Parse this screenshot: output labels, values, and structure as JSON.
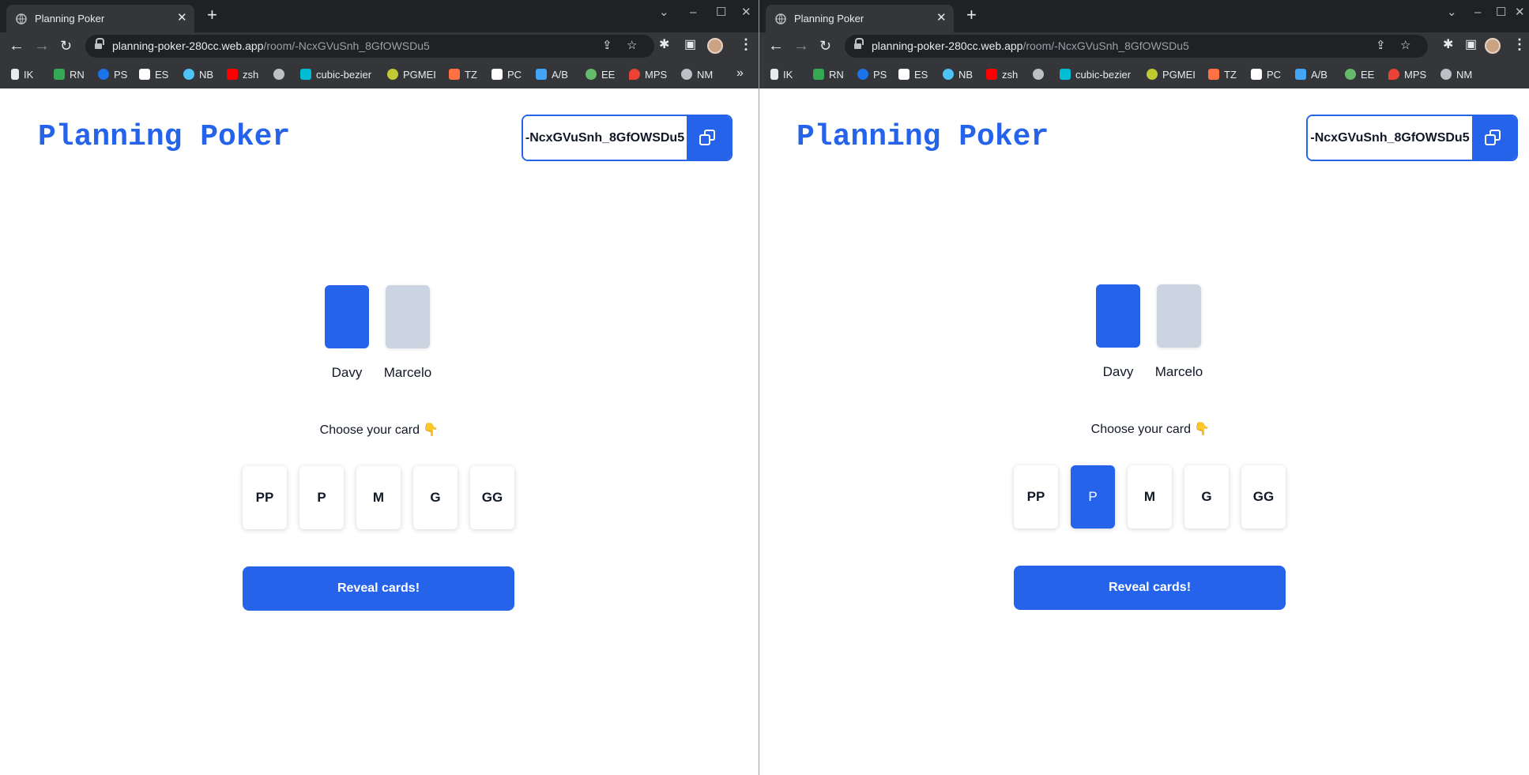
{
  "browser": {
    "tab_title": "Planning Poker",
    "url_host": "planning-poker-280cc.web.app",
    "url_path": "/room/-NcxGVuSnh_8GfOWSDu5",
    "bookmarks": [
      {
        "label": "IK",
        "color": "#e8eaed"
      },
      {
        "label": "RN",
        "color": "#34a853"
      },
      {
        "label": "PS",
        "color": "#1a73e8"
      },
      {
        "label": "ES",
        "color": "#ffffff"
      },
      {
        "label": "NB",
        "color": "#4fc3f7"
      },
      {
        "label": "zsh",
        "color": "#ff0000"
      },
      {
        "label": "",
        "color": "#bdc1c6"
      },
      {
        "label": "cubic-bezier",
        "color": "#00bcd4"
      },
      {
        "label": "PGMEI",
        "color": "#c0ca33"
      },
      {
        "label": "TZ",
        "color": "#ff7043"
      },
      {
        "label": "PC",
        "color": "#ffffff"
      },
      {
        "label": "A/B",
        "color": "#42a5f5"
      },
      {
        "label": "EE",
        "color": "#66bb6a"
      },
      {
        "label": "MPS",
        "color": "#ea4335"
      },
      {
        "label": "NM",
        "color": "#bdc1c6"
      }
    ],
    "more_label": "»"
  },
  "app": {
    "title": "Planning Poker",
    "room_id": "-NcxGVuSnh_8GfOWSDu5",
    "players": [
      {
        "name": "Davy",
        "status": "voted"
      },
      {
        "name": "Marcelo",
        "status": "waiting"
      }
    ],
    "prompt": "Choose your card 👇",
    "cards": [
      "PP",
      "P",
      "M",
      "G",
      "GG"
    ],
    "reveal_label": "Reveal cards!",
    "accent_color": "#2563eb"
  },
  "windows": {
    "left": {
      "selected_card": null
    },
    "right": {
      "selected_card": "P"
    }
  }
}
